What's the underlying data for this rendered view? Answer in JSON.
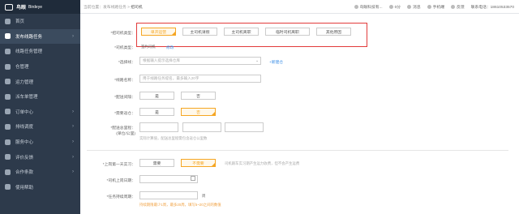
{
  "brand": {
    "name": "鸟眼",
    "en": "Birdeye"
  },
  "sidebar": {
    "items": [
      {
        "label": "首页",
        "active": false,
        "arrow": false
      },
      {
        "label": "发布线路任务",
        "active": true,
        "arrow": true
      },
      {
        "label": "线路任务管理",
        "active": false,
        "arrow": false
      },
      {
        "label": "仓管理",
        "active": false,
        "arrow": false
      },
      {
        "label": "运力管理",
        "active": false,
        "arrow": false
      },
      {
        "label": "派车单管理",
        "active": false,
        "arrow": false
      },
      {
        "label": "订单中心",
        "active": false,
        "arrow": true
      },
      {
        "label": "排线调度",
        "active": false,
        "arrow": true
      },
      {
        "label": "服务中心",
        "active": false,
        "arrow": true
      },
      {
        "label": "评价反馈",
        "active": false,
        "arrow": true
      },
      {
        "label": "合作条款",
        "active": false,
        "arrow": true
      },
      {
        "label": "使用帮助",
        "active": false,
        "arrow": false
      }
    ]
  },
  "topbar": {
    "crumb_prefix": "当前位置：发布线路任务 > ",
    "crumb_current": "招司机",
    "company": "鸟眼科技有...",
    "msgs": "0分",
    "notice": "消息",
    "device": "手机端",
    "feedback": "反馈",
    "phone": "联系电话：18610533570"
  },
  "form": {
    "recruit_type": {
      "label": "*招司机类型：",
      "options": [
        "单开运营",
        "主司机请假",
        "主司机离职",
        "临时司机离职",
        "其他原因"
      ]
    },
    "vehicle_type": {
      "label": "*司机类型：",
      "value": "签约司机",
      "link": "修改"
    },
    "route": {
      "label": "*选择线：",
      "placeholder": "根据输入提示选择仓库",
      "add": "+新建仓"
    },
    "route_name": {
      "label": "*线路名称：",
      "placeholder": "用于线路任务提名，最多输入20字"
    },
    "need_loading": {
      "label": "*配送间隔：",
      "options": [
        "是",
        "否"
      ]
    },
    "need_return": {
      "label": "*需要返仓：",
      "options": [
        "是",
        "否"
      ]
    },
    "delivery_area": {
      "label": "*配送总里程：",
      "sublabel": "(单位/公里)",
      "hint": "实际计算值，配送总里程需包含返仓公里数"
    },
    "last_day": {
      "label": "*上岗第一天实习：",
      "options": [
        "需要",
        "不需要"
      ],
      "hint": "司机跟车实习期产生运力收费，但不会产生运费"
    },
    "onboard_date": {
      "label": "*司机上岗日期："
    },
    "duration": {
      "label": "*任务持续周期：",
      "unit": "周",
      "hint": "持续期限最少1周，最多20周，填写5~20之间的数值"
    }
  }
}
